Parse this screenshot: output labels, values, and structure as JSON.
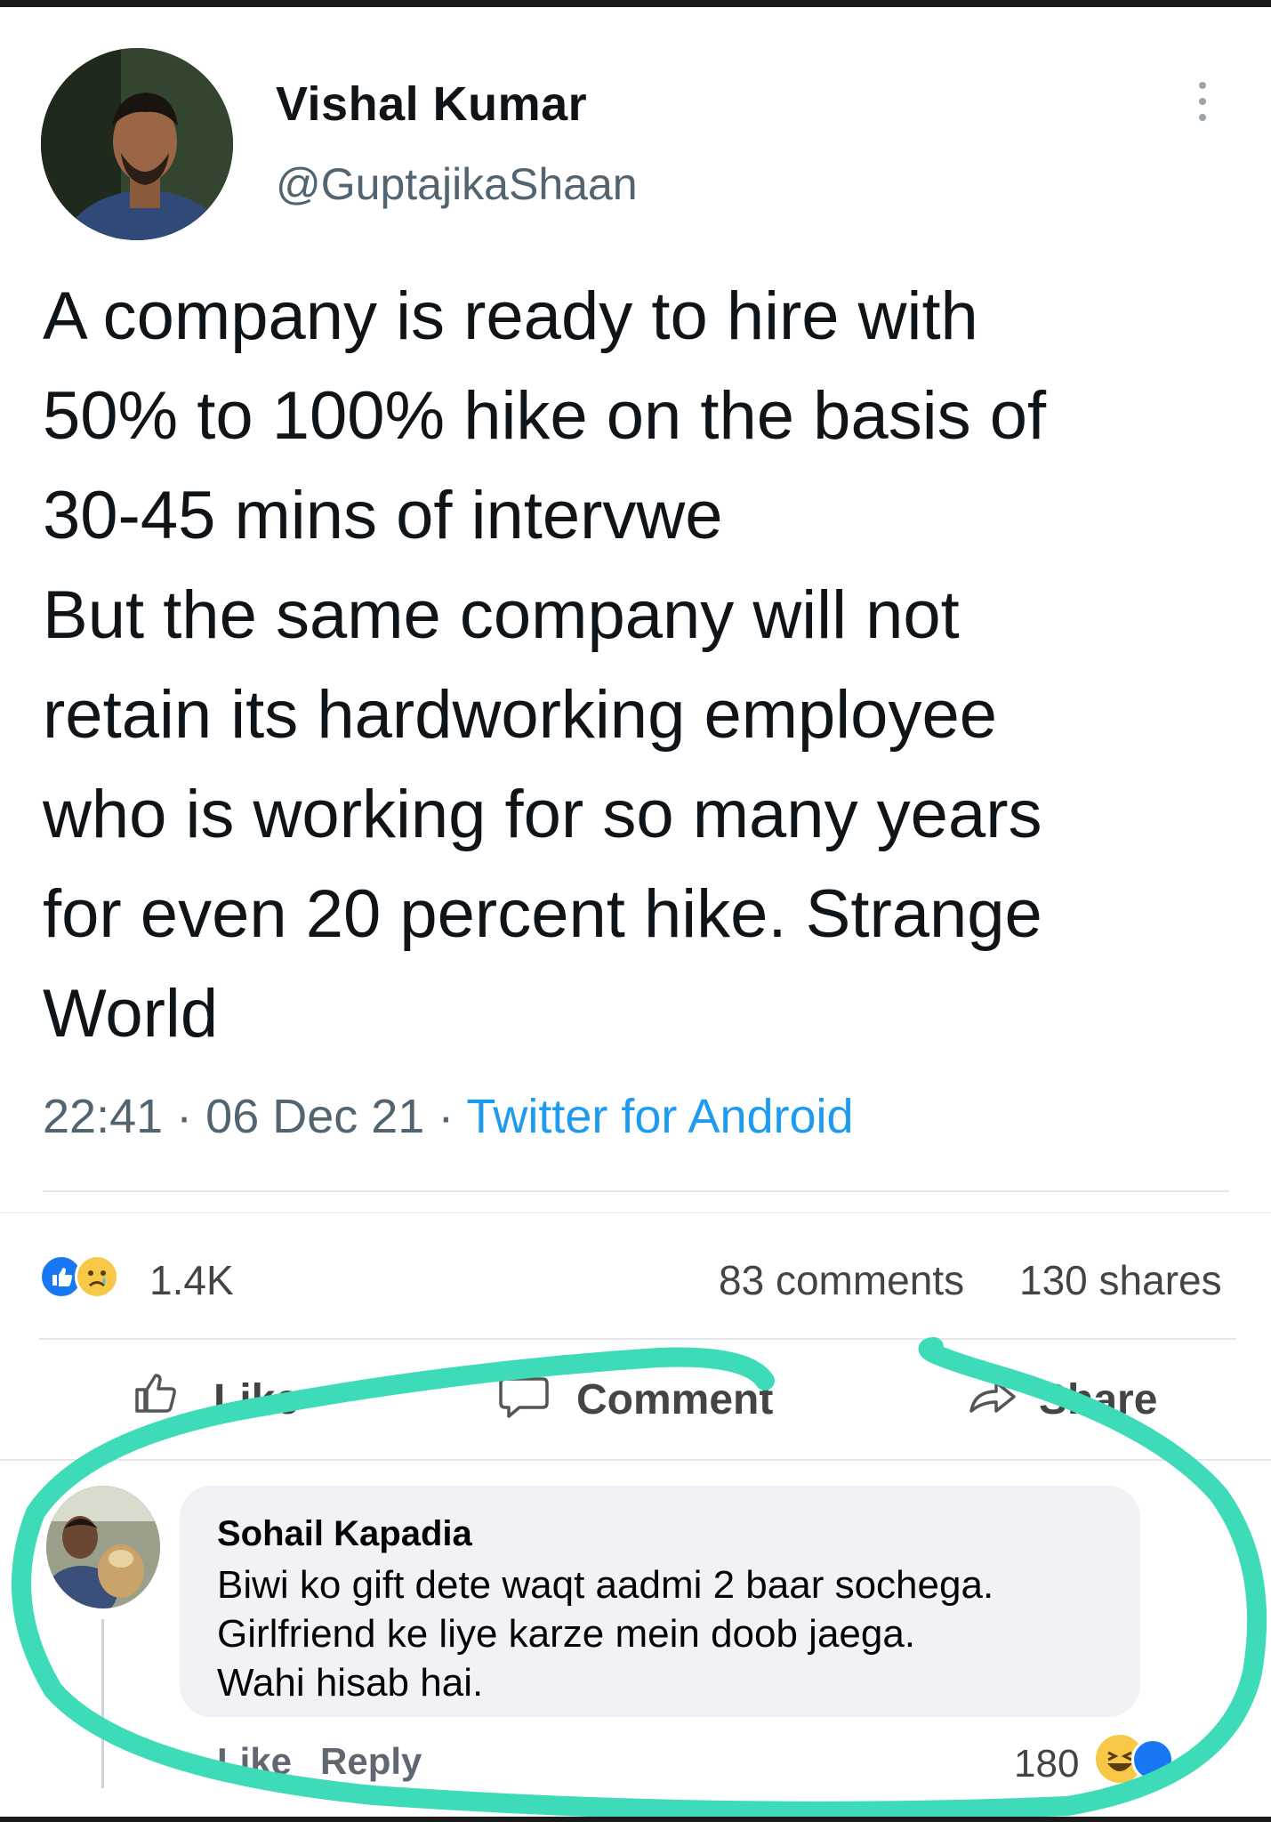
{
  "tweet": {
    "author_name": "Vishal Kumar",
    "author_handle": "@GuptajikaShaan",
    "text_lines": [
      "A company is ready to hire with",
      "50% to 100% hike on the basis of",
      "30-45 mins of intervwe",
      "But the same company will not",
      "retain its hardworking employee",
      "who is working for so many years",
      "for even 20 percent hike. Strange",
      "World"
    ],
    "time": "22:41",
    "date": "06 Dec 21",
    "separator": "·",
    "source": "Twitter for Android"
  },
  "post_stats": {
    "reaction_icons": [
      "like-reaction-icon",
      "sad-reaction-icon"
    ],
    "reaction_count": "1.4K",
    "comments": "83 comments",
    "shares": "130 shares"
  },
  "actions": {
    "like_label": "Like",
    "comment_label": "Comment",
    "share_label": "Share"
  },
  "comment": {
    "author": "Sohail Kapadia",
    "lines": [
      "Biwi ko gift dete waqt aadmi 2 baar sochega.",
      "Girlfriend ke liye karze mein doob jaega.",
      "Wahi hisab hai."
    ],
    "like_label": "Like",
    "reply_label": "Reply",
    "reaction_count": "180",
    "reaction_icons": [
      "haha-reaction-icon",
      "like-reaction-icon"
    ]
  },
  "colors": {
    "twitter_blue": "#1d9bf0",
    "facebook_blue": "#1877f2",
    "highlight_marker": "#3ddbb8",
    "muted_text": "#536471"
  }
}
